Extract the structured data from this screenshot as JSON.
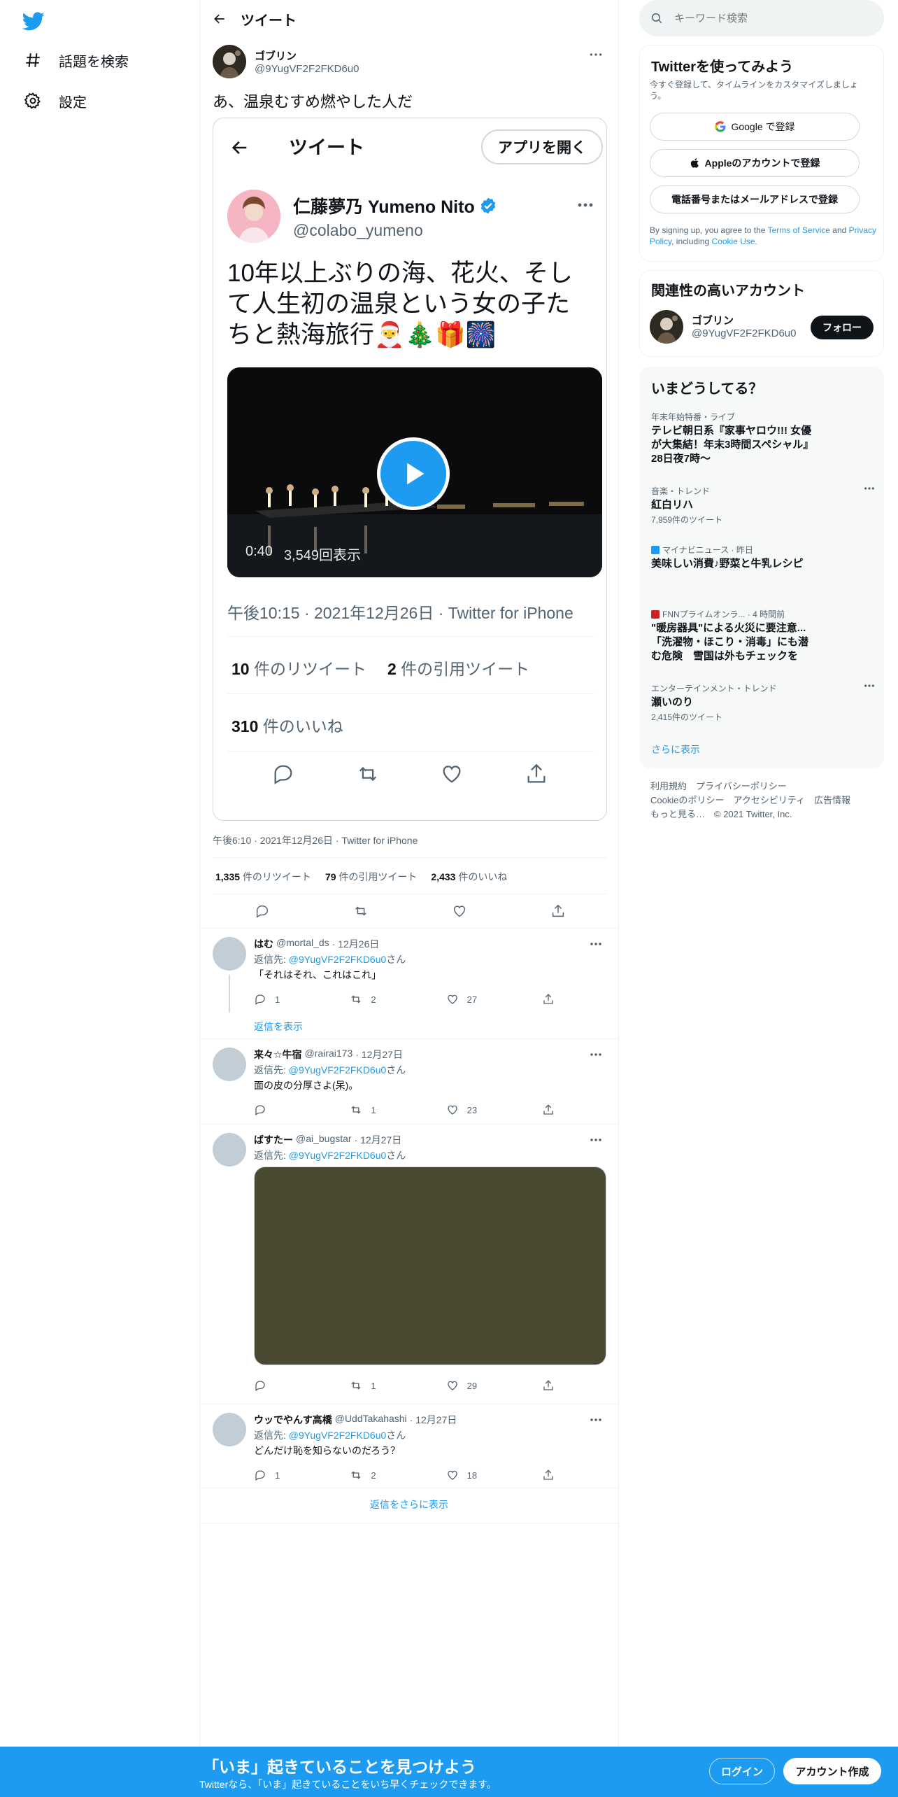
{
  "colors": {
    "accent": "#1d9bf0",
    "text": "#0f1419",
    "muted": "#536471"
  },
  "nav": {
    "logo_icon": "twitter-bird-icon",
    "items": [
      {
        "icon": "hashtag-icon",
        "label": "話題を検索"
      },
      {
        "icon": "gear-icon",
        "label": "設定"
      }
    ]
  },
  "header": {
    "title": "ツイート"
  },
  "tweet": {
    "name": "ゴブリン",
    "handle": "@9YugVF2F2FKD6u0",
    "text": "あ、温泉むすめ燃やした人だ",
    "embedded": {
      "title": "ツイート",
      "open_app": "アプリを開く",
      "name": "仁藤夢乃 Yumeno Nito",
      "handle": "@colabo_yumeno",
      "text": "10年以上ぶりの海、花火、そして人生初の温泉という女の子たちと熱海旅行🎅🎄🎁🎆",
      "video_duration": "0:40",
      "video_views": "3,549回表示",
      "date": "午後10:15 · 2021年12月26日 · Twitter for iPhone",
      "retweets_num": "10",
      "retweets_label": "件のリツイート",
      "quotes_num": "2",
      "quotes_label": "件の引用ツイート",
      "likes_num": "310",
      "likes_label": "件のいいね"
    },
    "meta": "午後6:10 · 2021年12月26日 · Twitter for iPhone",
    "retweets_num": "1,335",
    "retweets_label": "件のリツイート",
    "quotes_num": "79",
    "quotes_label": "件の引用ツイート",
    "likes_num": "2,433",
    "likes_label": "件のいいね"
  },
  "replies": [
    {
      "name": "はむ",
      "handle": "@mortal_ds",
      "date": "· 12月26日",
      "reply_prefix": "返信先:",
      "reply_to": "@9YugVF2F2FKD6u0",
      "reply_suffix": "さん",
      "text": "「それはそれ、これはこれ」",
      "replies": "1",
      "retweets": "2",
      "likes": "27",
      "show_replies": "返信を表示"
    },
    {
      "name": "来々☆牛宿",
      "handle": "@rairai173",
      "date": "· 12月27日",
      "reply_prefix": "返信先:",
      "reply_to": "@9YugVF2F2FKD6u0",
      "reply_suffix": "さん",
      "text": "面の皮の分厚さよ(呆)。",
      "replies": "",
      "retweets": "1",
      "likes": "23"
    },
    {
      "name": "ばすたー",
      "handle": "@ai_bugstar",
      "date": "· 12月27日",
      "reply_prefix": "返信先:",
      "reply_to": "@9YugVF2F2FKD6u0",
      "reply_suffix": "さん",
      "text": "",
      "replies": "",
      "retweets": "1",
      "likes": "29"
    },
    {
      "name": "ウッでやんす高橋",
      "handle": "@UddTakahashi",
      "date": "· 12月27日",
      "reply_prefix": "返信先:",
      "reply_to": "@9YugVF2F2FKD6u0",
      "reply_suffix": "さん",
      "text": "どんだけ恥を知らないのだろう？",
      "replies": "1",
      "retweets": "2",
      "likes": "18"
    }
  ],
  "show_more_replies": "返信をさらに表示",
  "right": {
    "search_placeholder": "キーワード検索",
    "signup": {
      "title": "Twitterを使ってみよう",
      "subtitle": "今すぐ登録して、タイムラインをカスタマイズしましょう。",
      "google": "Google で登録",
      "apple": "Appleのアカウントで登録",
      "phone": "電話番号またはメールアドレスで登録",
      "terms_prefix": "By signing up, you agree to the",
      "terms": "Terms of Service",
      "and": "and",
      "privacy": "Privacy Policy",
      "including": ", including",
      "cookie": "Cookie Use."
    },
    "related": {
      "title": "関連性の高いアカウント",
      "name": "ゴブリン",
      "handle": "@9YugVF2F2FKD6u0",
      "follow": "フォロー"
    },
    "trends": {
      "title": "いまどうしてる？",
      "items": [
        {
          "category": "年末年始特番・ライブ",
          "title": "テレビ朝日系『家事ヤロウ!!! 女優が大集結！年末3時間スペシャル』28日夜7時〜",
          "count": ""
        },
        {
          "category": "音楽・トレンド",
          "title": "紅白リハ",
          "count": "7,959件のツイート"
        },
        {
          "category": "マイナビニュース · 昨日",
          "title": "美味しい消費♪野菜と牛乳レシピ",
          "count": ""
        },
        {
          "category": "FNNプライムオンラ... · 4 時間前",
          "title": "\"暖房器具\"による火災に要注意...「洗濯物・ほこり・消毒」にも潜む危険　雪国は外もチェックを",
          "count": ""
        },
        {
          "category": "エンターテインメント・トレンド",
          "title": "瀬いのり",
          "count": "2,415件のツイート"
        }
      ],
      "show_more": "さらに表示"
    },
    "footer": {
      "line1": "利用規約　プライバシーポリシー",
      "line2": "Cookieのポリシー　アクセシビリティ　広告情報",
      "line3": "もっと見る…　© 2021 Twitter, Inc."
    }
  },
  "banner": {
    "title": "「いま」起きていることを見つけよう",
    "subtitle": "Twitterなら、「いま」起きていることをいち早くチェックできます。",
    "login": "ログイン",
    "signup": "アカウント作成"
  }
}
